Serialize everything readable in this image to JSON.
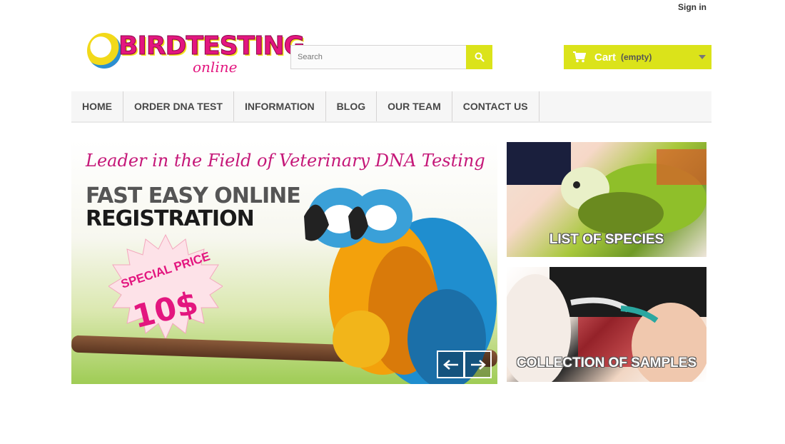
{
  "header": {
    "sign_in": "Sign in",
    "logo": {
      "word": "BIRDTESTING",
      "sub": "online"
    },
    "search": {
      "placeholder": "Search",
      "value": "",
      "icon": "search-icon"
    },
    "cart": {
      "label": "Cart",
      "status": "(empty)",
      "icon": "cart-icon"
    }
  },
  "menu": {
    "items": [
      {
        "label": "HOME"
      },
      {
        "label": "ORDER DNA TEST"
      },
      {
        "label": "INFORMATION"
      },
      {
        "label": "BLOG"
      },
      {
        "label": "OUR TEAM"
      },
      {
        "label": "CONTACT US"
      }
    ]
  },
  "slider": {
    "headline": "Leader in the Field of Veterinary DNA Testing",
    "line1": "FAST EASY ONLINE",
    "line2": "REGISTRATION",
    "badge_line1": "SPECIAL PRICE",
    "badge_line2": "10$"
  },
  "banners": [
    {
      "label": "LIST OF SPECIES"
    },
    {
      "label": "COLLECTION OF SAMPLES"
    }
  ],
  "colors": {
    "accent": "#dbe31a",
    "brand_pink": "#e3167f",
    "menu_bg": "#f6f6f6"
  }
}
